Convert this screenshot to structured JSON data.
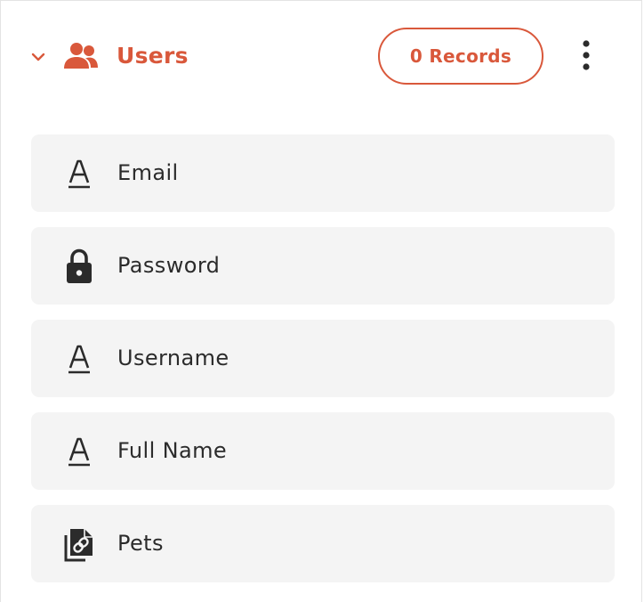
{
  "collection": {
    "title": "Users",
    "records_label": "0 Records",
    "accent_color": "#d9583b"
  },
  "fields": [
    {
      "label": "Email",
      "icon": "text-icon"
    },
    {
      "label": "Password",
      "icon": "lock-icon"
    },
    {
      "label": "Username",
      "icon": "text-icon"
    },
    {
      "label": "Full Name",
      "icon": "text-icon"
    },
    {
      "label": "Pets",
      "icon": "relation-icon"
    }
  ]
}
